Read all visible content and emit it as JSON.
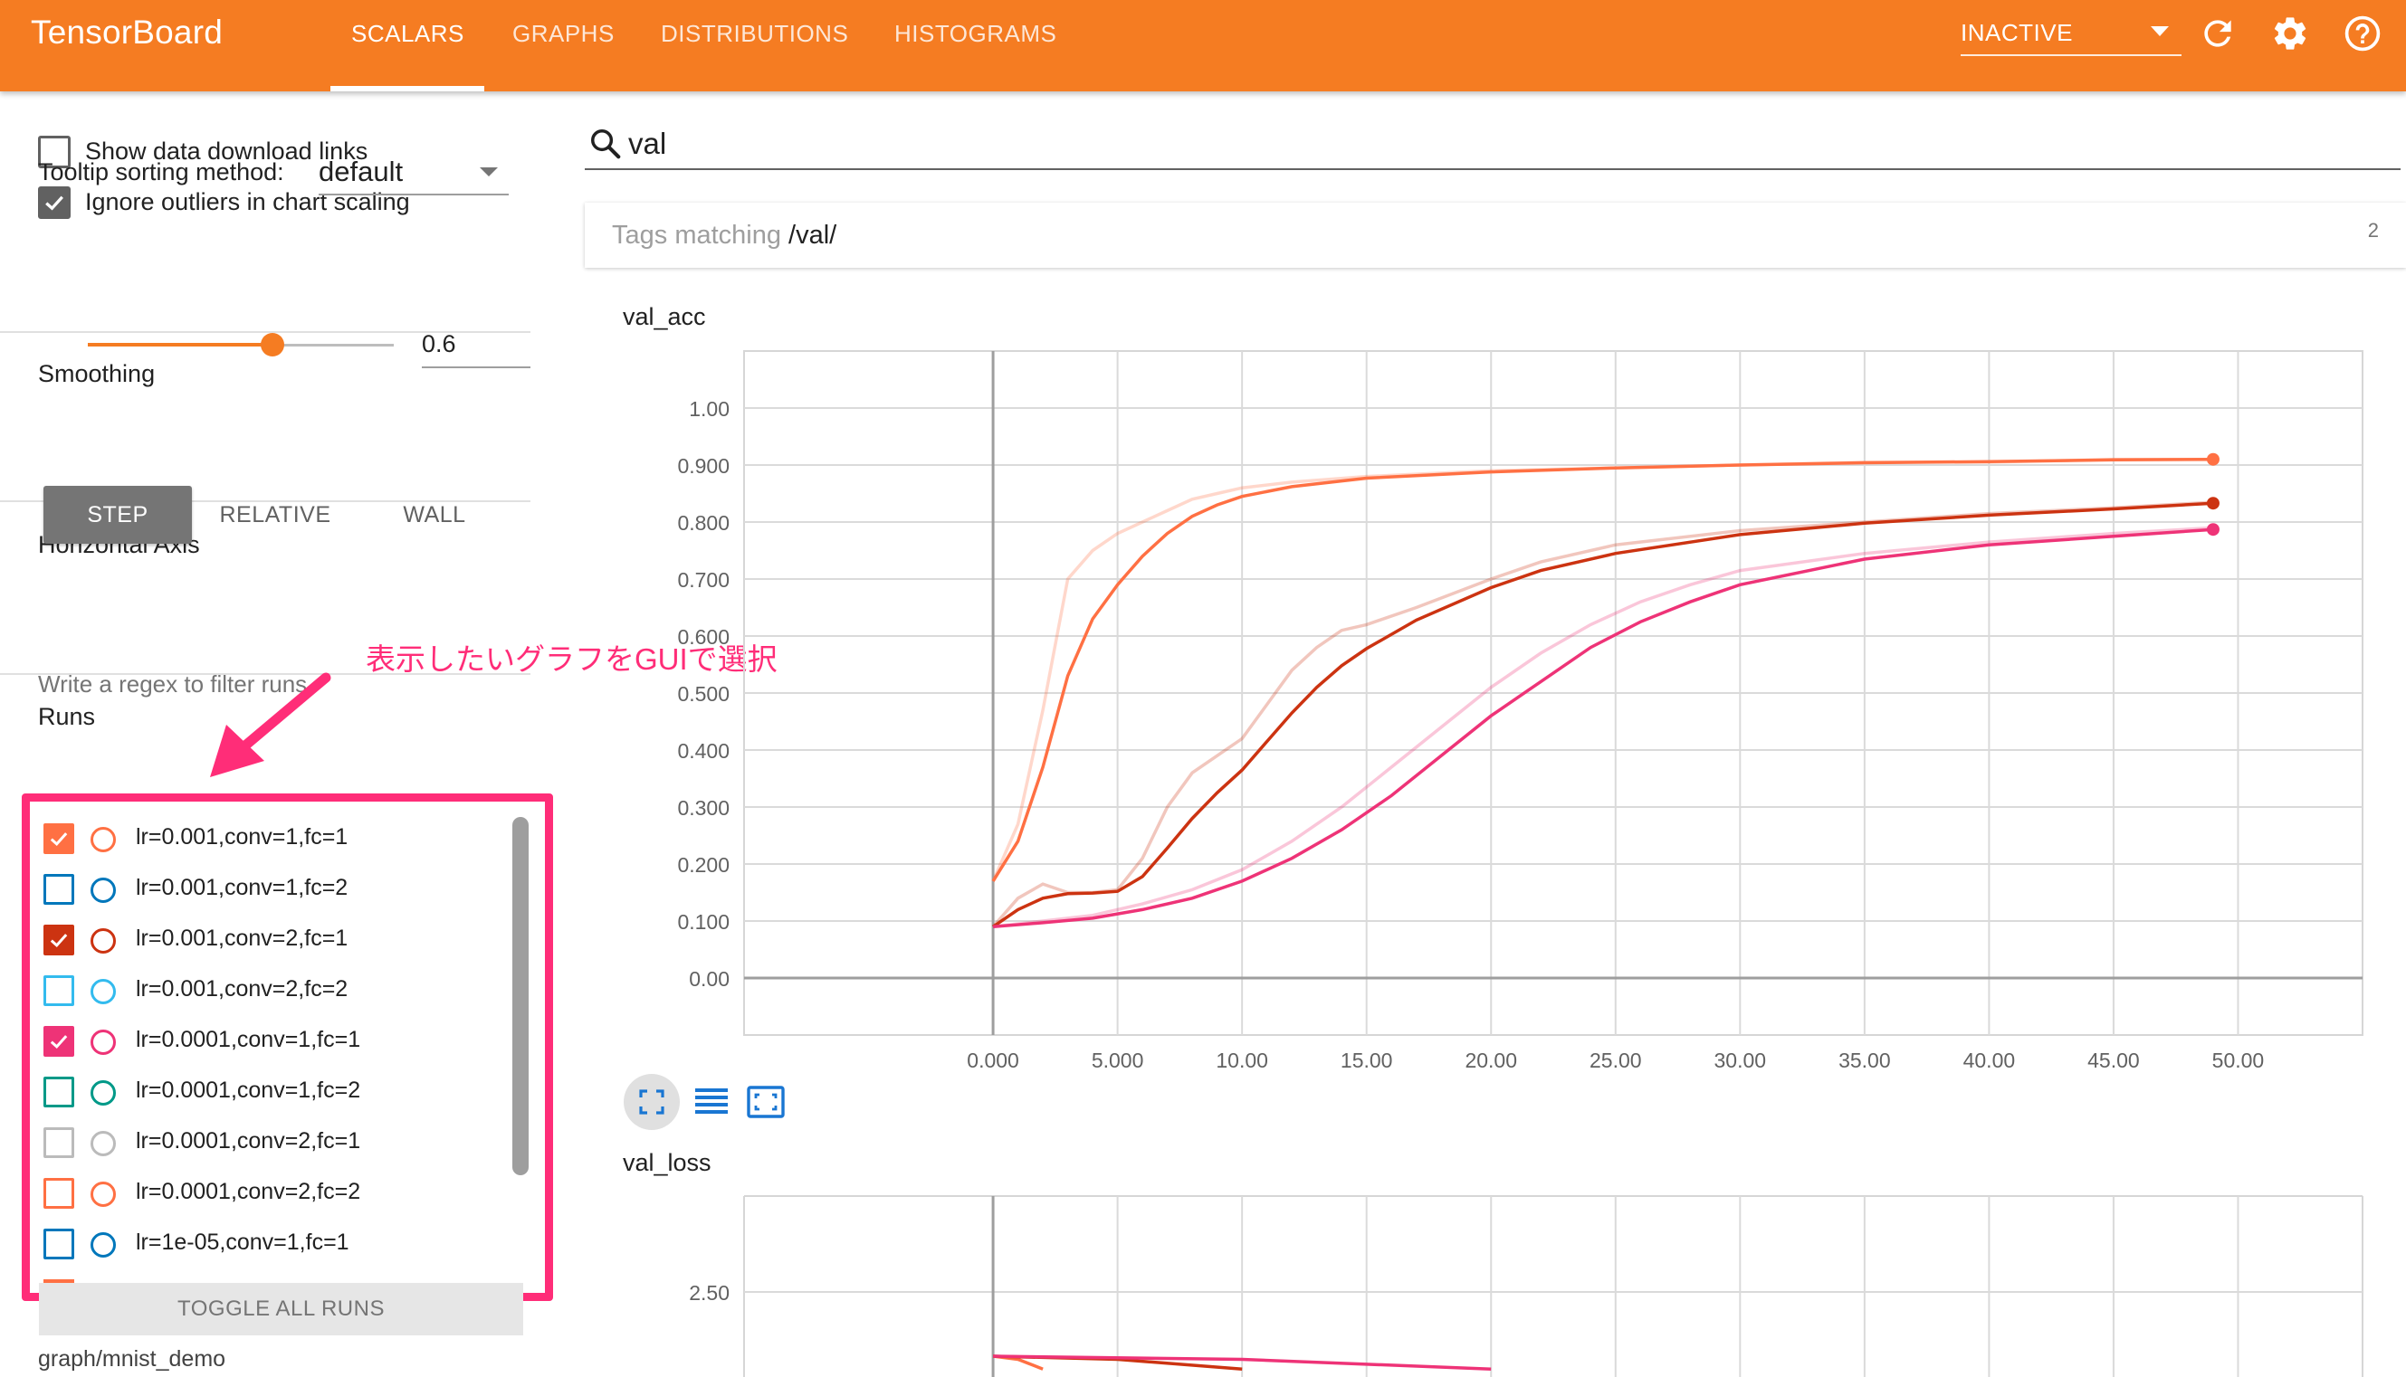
{
  "app": {
    "title": "TensorBoard"
  },
  "nav": {
    "tabs": [
      {
        "label": "SCALARS",
        "active": true
      },
      {
        "label": "GRAPHS"
      },
      {
        "label": "DISTRIBUTIONS"
      },
      {
        "label": "HISTOGRAMS"
      }
    ],
    "status_select": "INACTIVE",
    "icons": [
      "refresh-icon",
      "settings-icon",
      "help-icon"
    ]
  },
  "sidebar": {
    "show_download_links": {
      "label": "Show data download links",
      "checked": false
    },
    "ignore_outliers": {
      "label": "Ignore outliers in chart scaling",
      "checked": true
    },
    "tooltip_sorting": {
      "label": "Tooltip sorting method:",
      "value": "default"
    },
    "smoothing": {
      "title": "Smoothing",
      "value": "0.6",
      "fraction": 0.6
    },
    "horizontal_axis": {
      "title": "Horizontal Axis",
      "options": [
        "STEP",
        "RELATIVE",
        "WALL"
      ],
      "selected": "STEP"
    },
    "runs": {
      "title": "Runs",
      "regex_placeholder": "Write a regex to filter runs",
      "items": [
        {
          "label": "lr=0.001,conv=1,fc=1",
          "checked": true,
          "color": "#ff7043"
        },
        {
          "label": "lr=0.001,conv=1,fc=2",
          "checked": false,
          "color": "#0077bb"
        },
        {
          "label": "lr=0.001,conv=2,fc=1",
          "checked": true,
          "color": "#cc3311"
        },
        {
          "label": "lr=0.001,conv=2,fc=2",
          "checked": false,
          "color": "#33bbee"
        },
        {
          "label": "lr=0.0001,conv=1,fc=1",
          "checked": true,
          "color": "#ee3377"
        },
        {
          "label": "lr=0.0001,conv=1,fc=2",
          "checked": false,
          "color": "#009988"
        },
        {
          "label": "lr=0.0001,conv=2,fc=1",
          "checked": false,
          "color": "#bbbbbb"
        },
        {
          "label": "lr=0.0001,conv=2,fc=2",
          "checked": false,
          "color": "#ff7043"
        },
        {
          "label": "lr=1e-05,conv=1,fc=1",
          "checked": false,
          "color": "#0077bb"
        }
      ],
      "toggle_all_label": "TOGGLE ALL RUNS",
      "footer": "graph/mnist_demo"
    }
  },
  "main": {
    "search_value": "val",
    "tags_matching": {
      "prefix": "Tags matching ",
      "pattern": "/val/",
      "count": "2"
    },
    "toolbar_icons": [
      "fit-to-data-icon",
      "data-table-icon",
      "fit-domain-icon"
    ]
  },
  "annotation": "表示したいグラフをGUIで選択",
  "chart_data": [
    {
      "type": "line",
      "title": "val_acc",
      "xlim": [
        -10,
        55
      ],
      "ylim": [
        -0.1,
        1.1
      ],
      "x_ticks": [
        "0.000",
        "5.000",
        "10.00",
        "15.00",
        "20.00",
        "25.00",
        "30.00",
        "35.00",
        "40.00",
        "45.00",
        "50.00"
      ],
      "y_ticks": [
        "0.00",
        "0.100",
        "0.200",
        "0.300",
        "0.400",
        "0.500",
        "0.600",
        "0.700",
        "0.800",
        "0.900",
        "1.00"
      ],
      "grid": true,
      "series": [
        {
          "color": "#ff7043",
          "raw": [
            [
              0,
              0.17
            ],
            [
              1,
              0.27
            ],
            [
              2,
              0.47
            ],
            [
              3,
              0.7
            ],
            [
              4,
              0.75
            ],
            [
              5,
              0.78
            ],
            [
              6,
              0.8
            ],
            [
              7,
              0.82
            ],
            [
              8,
              0.84
            ],
            [
              9,
              0.85
            ],
            [
              10,
              0.86
            ],
            [
              12,
              0.87
            ],
            [
              15,
              0.88
            ],
            [
              20,
              0.89
            ],
            [
              25,
              0.895
            ],
            [
              30,
              0.9
            ],
            [
              35,
              0.905
            ],
            [
              40,
              0.905
            ],
            [
              45,
              0.91
            ],
            [
              49,
              0.91
            ]
          ],
          "smoothed": [
            [
              0,
              0.17
            ],
            [
              1,
              0.24
            ],
            [
              2,
              0.37
            ],
            [
              3,
              0.53
            ],
            [
              4,
              0.63
            ],
            [
              5,
              0.69
            ],
            [
              6,
              0.74
            ],
            [
              7,
              0.78
            ],
            [
              8,
              0.81
            ],
            [
              9,
              0.83
            ],
            [
              10,
              0.845
            ],
            [
              12,
              0.862
            ],
            [
              15,
              0.877
            ],
            [
              20,
              0.888
            ],
            [
              25,
              0.895
            ],
            [
              30,
              0.9
            ],
            [
              35,
              0.904
            ],
            [
              40,
              0.906
            ],
            [
              45,
              0.909
            ],
            [
              49,
              0.91
            ]
          ]
        },
        {
          "color": "#cc3311",
          "raw": [
            [
              0,
              0.09
            ],
            [
              1,
              0.14
            ],
            [
              2,
              0.165
            ],
            [
              3,
              0.15
            ],
            [
              4,
              0.15
            ],
            [
              5,
              0.155
            ],
            [
              6,
              0.21
            ],
            [
              7,
              0.3
            ],
            [
              8,
              0.36
            ],
            [
              9,
              0.39
            ],
            [
              10,
              0.42
            ],
            [
              11,
              0.48
            ],
            [
              12,
              0.54
            ],
            [
              13,
              0.58
            ],
            [
              14,
              0.61
            ],
            [
              15,
              0.62
            ],
            [
              17,
              0.65
            ],
            [
              20,
              0.7
            ],
            [
              22,
              0.73
            ],
            [
              25,
              0.76
            ],
            [
              30,
              0.785
            ],
            [
              35,
              0.8
            ],
            [
              40,
              0.815
            ],
            [
              45,
              0.825
            ],
            [
              49,
              0.835
            ]
          ],
          "smoothed": [
            [
              0,
              0.09
            ],
            [
              1,
              0.12
            ],
            [
              2,
              0.14
            ],
            [
              3,
              0.148
            ],
            [
              4,
              0.149
            ],
            [
              5,
              0.152
            ],
            [
              6,
              0.178
            ],
            [
              7,
              0.228
            ],
            [
              8,
              0.28
            ],
            [
              9,
              0.325
            ],
            [
              10,
              0.365
            ],
            [
              11,
              0.415
            ],
            [
              12,
              0.465
            ],
            [
              13,
              0.51
            ],
            [
              14,
              0.548
            ],
            [
              15,
              0.578
            ],
            [
              17,
              0.628
            ],
            [
              20,
              0.685
            ],
            [
              22,
              0.715
            ],
            [
              25,
              0.745
            ],
            [
              30,
              0.778
            ],
            [
              35,
              0.798
            ],
            [
              40,
              0.812
            ],
            [
              45,
              0.823
            ],
            [
              49,
              0.833
            ]
          ]
        },
        {
          "color": "#ee3377",
          "raw": [
            [
              0,
              0.09
            ],
            [
              2,
              0.1
            ],
            [
              4,
              0.11
            ],
            [
              6,
              0.13
            ],
            [
              8,
              0.155
            ],
            [
              10,
              0.19
            ],
            [
              12,
              0.24
            ],
            [
              14,
              0.3
            ],
            [
              16,
              0.37
            ],
            [
              18,
              0.44
            ],
            [
              20,
              0.51
            ],
            [
              22,
              0.57
            ],
            [
              24,
              0.62
            ],
            [
              26,
              0.66
            ],
            [
              28,
              0.69
            ],
            [
              30,
              0.715
            ],
            [
              35,
              0.745
            ],
            [
              40,
              0.765
            ],
            [
              45,
              0.78
            ],
            [
              49,
              0.79
            ]
          ],
          "smoothed": [
            [
              0,
              0.09
            ],
            [
              2,
              0.097
            ],
            [
              4,
              0.105
            ],
            [
              6,
              0.12
            ],
            [
              8,
              0.14
            ],
            [
              10,
              0.17
            ],
            [
              12,
              0.21
            ],
            [
              14,
              0.26
            ],
            [
              16,
              0.32
            ],
            [
              18,
              0.39
            ],
            [
              20,
              0.46
            ],
            [
              22,
              0.52
            ],
            [
              24,
              0.58
            ],
            [
              26,
              0.625
            ],
            [
              28,
              0.66
            ],
            [
              30,
              0.69
            ],
            [
              35,
              0.735
            ],
            [
              40,
              0.76
            ],
            [
              45,
              0.775
            ],
            [
              49,
              0.787
            ]
          ]
        }
      ]
    },
    {
      "type": "line",
      "title": "val_loss",
      "y_ticks": [
        "2.50"
      ],
      "grid": true,
      "series": [
        {
          "color": "#ff7043",
          "smoothed": [
            [
              0,
              2.3
            ],
            [
              1,
              2.29
            ],
            [
              2,
              2.26
            ]
          ]
        },
        {
          "color": "#cc3311",
          "smoothed": [
            [
              0,
              2.3
            ],
            [
              5,
              2.29
            ],
            [
              10,
              2.26
            ]
          ]
        },
        {
          "color": "#ee3377",
          "smoothed": [
            [
              0,
              2.3
            ],
            [
              10,
              2.29
            ],
            [
              20,
              2.26
            ]
          ]
        }
      ]
    }
  ]
}
